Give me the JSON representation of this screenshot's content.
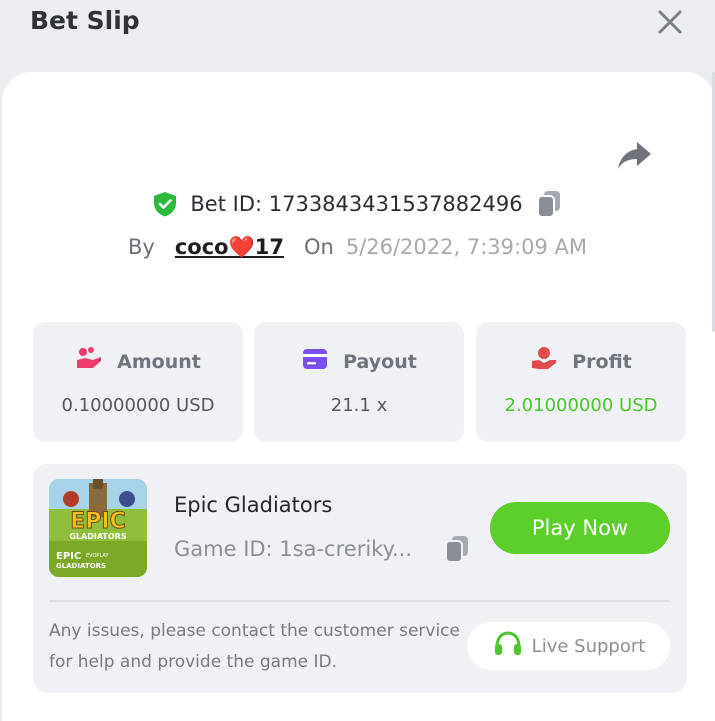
{
  "header": {
    "title": "Bet Slip"
  },
  "bet": {
    "id_text": "Bet ID: 1733843431537882496",
    "by_label": "By",
    "username": "coco❤️17",
    "on_label": "On",
    "datetime": "5/26/2022, 7:39:09 AM"
  },
  "stats": {
    "amount": {
      "label": "Amount",
      "value": "0.10000000 USD"
    },
    "payout": {
      "label": "Payout",
      "value": "21.1 x"
    },
    "profit": {
      "label": "Profit",
      "value": "2.01000000 USD"
    }
  },
  "game": {
    "name": "Epic Gladiators",
    "id_text": "Game ID: 1sa-creriky...",
    "thumb_title": "EPIC",
    "thumb_sub": "GLADIATORS",
    "thumb_small": "EPIC",
    "thumb_small2": "GLADIATORS",
    "thumb_brand": "EVOPLAY",
    "play_label": "Play Now",
    "help_text": "Any issues, please contact the customer service for help and provide the game ID.",
    "support_label": "Live Support"
  },
  "icons": {
    "close": "close-icon",
    "share": "share-icon",
    "verified": "shield-check-icon",
    "copy": "copy-icon",
    "amount": "coins-hand-icon",
    "payout": "card-icon",
    "profit": "profit-hand-icon",
    "support": "headset-icon"
  },
  "colors": {
    "accent_green": "#5ccf2a",
    "profit_green": "#4cc62a",
    "verified_green": "#2dba3c",
    "payout_purple": "#7b4ef2",
    "amount_pink": "#ee3c6e",
    "profit_red": "#e24b4b"
  }
}
